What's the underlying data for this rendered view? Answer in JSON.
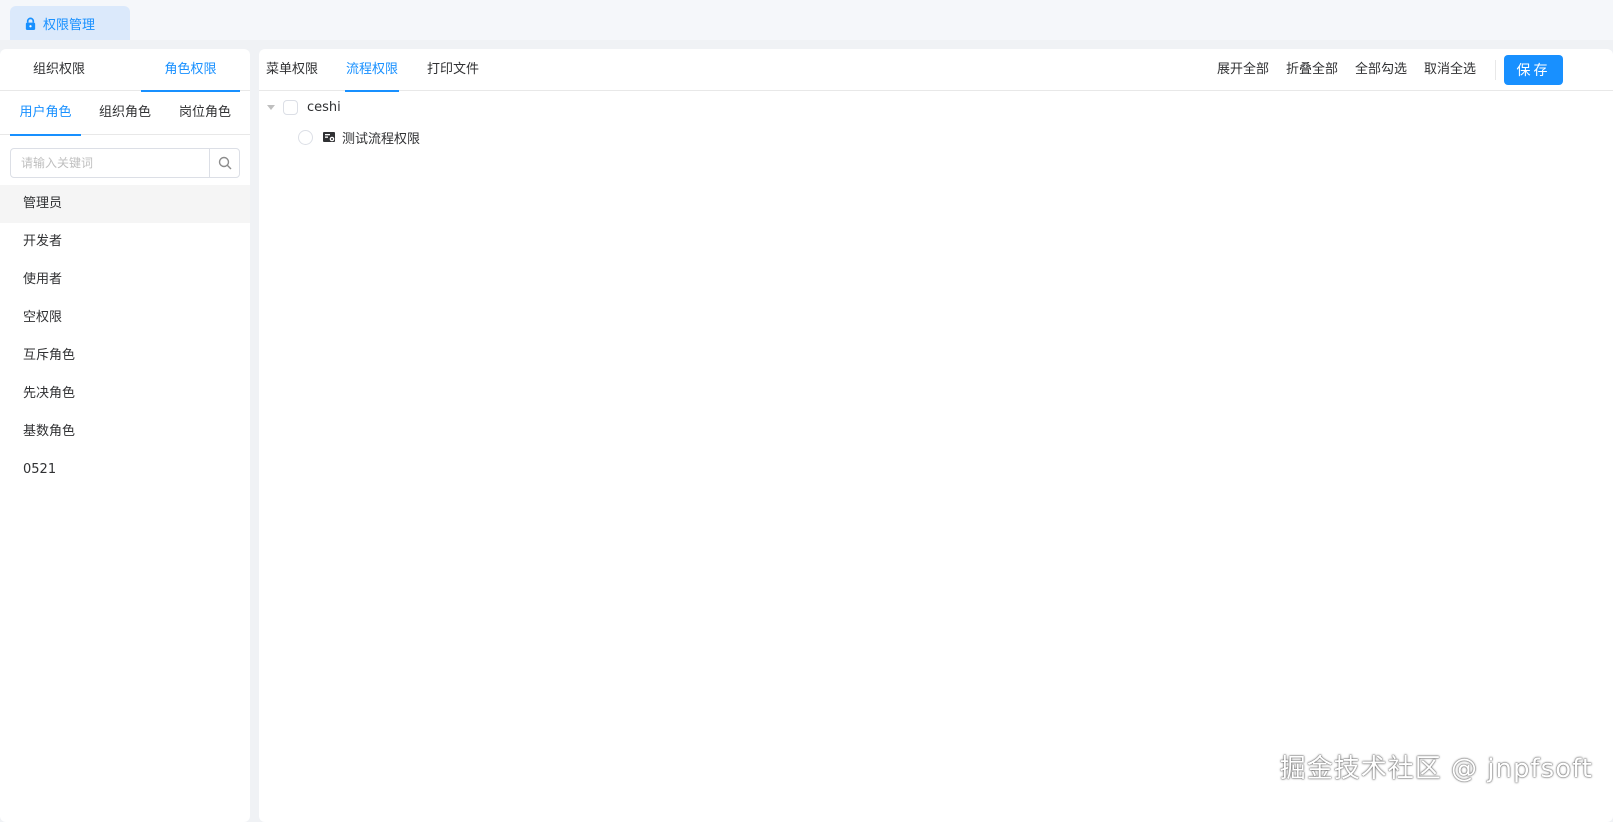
{
  "page_tab": {
    "label": "权限管理",
    "icon": "lock-icon"
  },
  "left": {
    "top_tabs": [
      "组织权限",
      "角色权限"
    ],
    "active_top_tab": "角色权限",
    "sub_tabs": [
      "用户角色",
      "组织角色",
      "岗位角色"
    ],
    "active_sub_tab": "用户角色",
    "search": {
      "placeholder": "请输入关键词",
      "value": ""
    },
    "roles": [
      "管理员",
      "开发者",
      "使用者",
      "空权限",
      "互斥角色",
      "先决角色",
      "基数角色",
      "0521"
    ],
    "selected_role": "管理员"
  },
  "right": {
    "tabs": [
      "菜单权限",
      "流程权限",
      "打印文件"
    ],
    "active_tab": "流程权限",
    "actions": [
      "展开全部",
      "折叠全部",
      "全部勾选",
      "取消全选"
    ],
    "save_label": "保存",
    "tree": {
      "root": {
        "label": "ceshi",
        "expanded": true,
        "checked": false
      },
      "children": [
        {
          "label": "测试流程权限",
          "icon": "flow-form-icon",
          "checked": false
        }
      ]
    }
  },
  "watermark": "掘金技术社区 @ jnpfsoft",
  "colors": {
    "accent": "#1890ff",
    "background": "#f0f2f5",
    "tab_bg": "#dbe9fb"
  }
}
